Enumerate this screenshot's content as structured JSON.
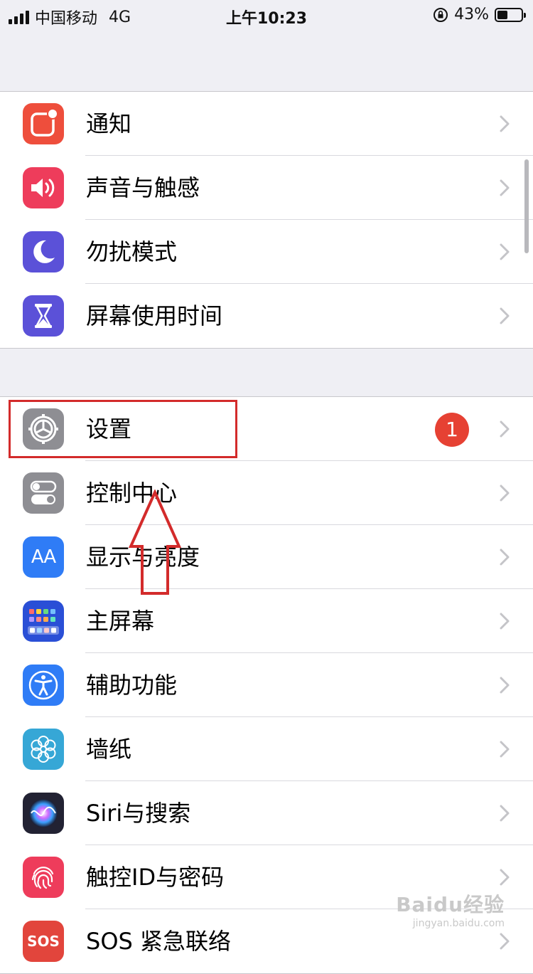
{
  "status_bar": {
    "carrier": "中国移动",
    "network": "4G",
    "time": "上午10:23",
    "battery": "43%",
    "battery_level": 0.43
  },
  "groups": [
    {
      "items": [
        {
          "label": "通知",
          "icon": "notifications-icon",
          "color": "#ee4e3c"
        },
        {
          "label": "声音与触感",
          "icon": "speaker-icon",
          "color": "#ee3c5b"
        },
        {
          "label": "勿扰模式",
          "icon": "moon-icon",
          "color": "#5b51d8"
        },
        {
          "label": "屏幕使用时间",
          "icon": "hourglass-icon",
          "color": "#5b51d8"
        }
      ]
    },
    {
      "items": [
        {
          "label": "设置",
          "icon": "gear-icon",
          "color": "#8e8e93",
          "badge": "1"
        },
        {
          "label": "控制中心",
          "icon": "toggles-icon",
          "color": "#8e8e93"
        },
        {
          "label": "显示与亮度",
          "icon": "text-size-icon",
          "color": "#2f7cf6"
        },
        {
          "label": "主屏幕",
          "icon": "home-screen-icon",
          "color": "#2a4fd6"
        },
        {
          "label": "辅助功能",
          "icon": "accessibility-icon",
          "color": "#2f7cf6"
        },
        {
          "label": "墙纸",
          "icon": "flower-icon",
          "color": "#36a7d6"
        },
        {
          "label": "Siri与搜索",
          "icon": "siri-icon",
          "color": "#222233"
        },
        {
          "label": "触控ID与密码",
          "icon": "fingerprint-icon",
          "color": "#ee3c5b"
        },
        {
          "label": "SOS 紧急联络",
          "icon": "sos-icon",
          "color": "#e2453c"
        }
      ]
    }
  ],
  "icon_text": {
    "text_size": "AA",
    "sos": "SOS"
  },
  "watermark": {
    "brand": "Baidu经验",
    "url": "jingyan.baidu.com"
  }
}
